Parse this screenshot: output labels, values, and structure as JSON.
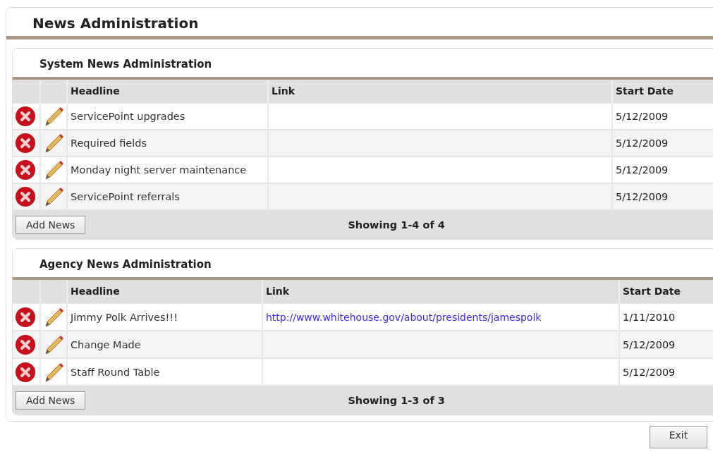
{
  "title": "News Administration",
  "panels": [
    {
      "title": "System News Administration",
      "columns": [
        "Headline",
        "Link",
        "Start Date"
      ],
      "rows": [
        {
          "headline": "ServicePoint upgrades",
          "link": "",
          "start_date": "5/12/2009"
        },
        {
          "headline": "Required fields",
          "link": "",
          "start_date": "5/12/2009"
        },
        {
          "headline": "Monday night server maintenance",
          "link": "",
          "start_date": "5/12/2009"
        },
        {
          "headline": "ServicePoint referrals",
          "link": "",
          "start_date": "5/12/2009"
        }
      ],
      "add_button": "Add News",
      "summary": "Showing 1-4 of 4"
    },
    {
      "title": "Agency News Administration",
      "columns": [
        "Headline",
        "Link",
        "Start Date"
      ],
      "rows": [
        {
          "headline": "Jimmy Polk Arrives!!!",
          "link": "http://www.whitehouse.gov/about/presidents/jamespolk",
          "start_date": "1/11/2010"
        },
        {
          "headline": "Change Made",
          "link": "",
          "start_date": "5/12/2009"
        },
        {
          "headline": "Staff Round Table",
          "link": "",
          "start_date": "5/12/2009"
        }
      ],
      "add_button": "Add News",
      "summary": "Showing 1-3 of 3"
    }
  ],
  "exit_button": "Exit"
}
